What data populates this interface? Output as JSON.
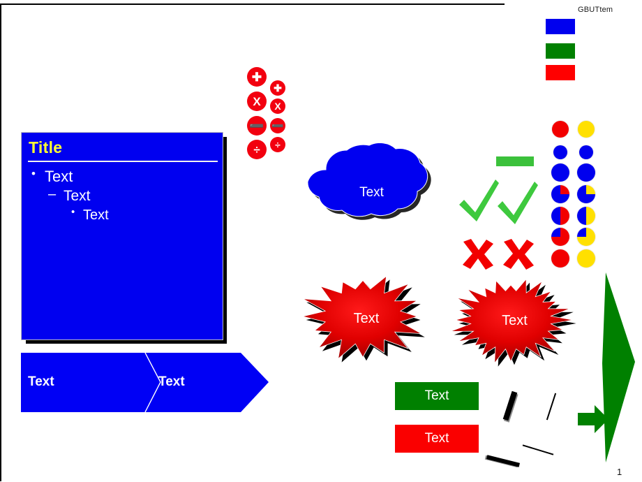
{
  "header": {
    "label": "GBUTtem"
  },
  "legend": {
    "items": [
      {
        "name": "blue-swatch",
        "color": "#0000ee"
      },
      {
        "name": "green-swatch",
        "color": "#008000"
      },
      {
        "name": "red-swatch",
        "color": "#ff0000"
      }
    ]
  },
  "content_box": {
    "title": "Title",
    "bullets": [
      {
        "marker": "•",
        "text": "Text",
        "level": 1
      },
      {
        "marker": "–",
        "text": "Text",
        "level": 2
      },
      {
        "marker": "•",
        "text": "Text",
        "level": 3
      }
    ],
    "fill_color": "#0000f0",
    "title_color": "#ffff33"
  },
  "chevron": {
    "segments": [
      {
        "label": "Text"
      },
      {
        "label": "Text"
      }
    ],
    "fill_color": "#0000f5"
  },
  "operators": {
    "large": [
      {
        "name": "plus",
        "glyph": "✚"
      },
      {
        "name": "times",
        "glyph": "X"
      },
      {
        "name": "minus",
        "glyph": "➖"
      },
      {
        "name": "divide",
        "glyph": "÷"
      }
    ],
    "small": [
      {
        "name": "plus",
        "glyph": "✚"
      },
      {
        "name": "times",
        "glyph": "X"
      },
      {
        "name": "minus",
        "glyph": "➖"
      },
      {
        "name": "divide",
        "glyph": "÷"
      }
    ],
    "color": "#f2000f"
  },
  "cloud": {
    "label": "Text",
    "fill_color": "#0000f0"
  },
  "marks": {
    "dash_color": "#3bc13b",
    "check_color": "#3ec93e",
    "cross_color": "#f20000",
    "checks": 2,
    "crosses": 2
  },
  "pie_grid": {
    "columns": [
      "red",
      "yellow"
    ],
    "left_color": "#f20000",
    "right_color": "#ffe000",
    "base_color": "#0000ee",
    "rows": [
      {
        "percent": 100,
        "size": 24
      },
      {
        "percent": 0,
        "size": 20
      },
      {
        "percent": 0,
        "size": 26
      },
      {
        "percent": 25,
        "size": 26
      },
      {
        "percent": 50,
        "size": 26
      },
      {
        "percent": 75,
        "size": 26
      },
      {
        "percent": 100,
        "size": 26
      }
    ]
  },
  "starbursts": [
    {
      "name": "starburst-16-point",
      "label": "Text",
      "points": 16,
      "fill_color": "#d40000"
    },
    {
      "name": "starburst-24-point",
      "label": "Text",
      "points": 24,
      "fill_color": "#d40000"
    }
  ],
  "banners": [
    {
      "name": "green-banner",
      "label": "Text",
      "color": "#008000"
    },
    {
      "name": "red-banner",
      "label": "Text",
      "color": "#fa0000"
    }
  ],
  "diagonal_lines": [
    {
      "name": "thick-line-1",
      "style": "thick-shadow"
    },
    {
      "name": "thin-line-1",
      "style": "thin"
    },
    {
      "name": "thick-line-2",
      "style": "thick-shadow"
    },
    {
      "name": "thin-line-2",
      "style": "thin"
    }
  ],
  "green_arrow": {
    "color": "#008000"
  },
  "green_kite": {
    "color": "#008000"
  },
  "footer": {
    "slide_number": "1"
  }
}
